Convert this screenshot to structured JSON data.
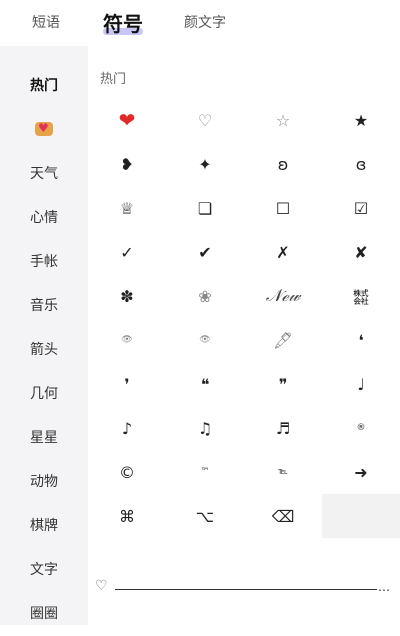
{
  "tabs": [
    {
      "label": "短语"
    },
    {
      "label": "符号"
    },
    {
      "label": "颜文字"
    }
  ],
  "sidebar": {
    "items": [
      {
        "label": "热门"
      },
      {
        "label": ""
      },
      {
        "label": "天气"
      },
      {
        "label": "心情"
      },
      {
        "label": "手帐"
      },
      {
        "label": "音乐"
      },
      {
        "label": "箭头"
      },
      {
        "label": "几何"
      },
      {
        "label": "星星"
      },
      {
        "label": "动物"
      },
      {
        "label": "棋牌"
      },
      {
        "label": "文字"
      },
      {
        "label": "圈圈"
      }
    ]
  },
  "main": {
    "section_title": "热门",
    "symbols": [
      "❤",
      "♡",
      "☆",
      "★",
      "❥",
      "✦",
      "ʚ",
      "ɞ",
      "♕",
      "❏",
      "☐",
      "☑",
      "✓",
      "✔",
      "✗",
      "✘",
      "✽",
      "❀",
      "𝒩ℯ𝓌",
      "㍿",
      "👁",
      "👁",
      "🖋",
      "❛",
      "❜",
      "❝",
      "❞",
      "♩",
      "♪",
      "♫",
      "♬",
      "®",
      "©",
      "™",
      "℡",
      "➜",
      "⌘",
      "⌥",
      "⌫",
      ""
    ]
  },
  "bottom": {
    "left_symbol": "♡",
    "ellipsis": "…"
  }
}
